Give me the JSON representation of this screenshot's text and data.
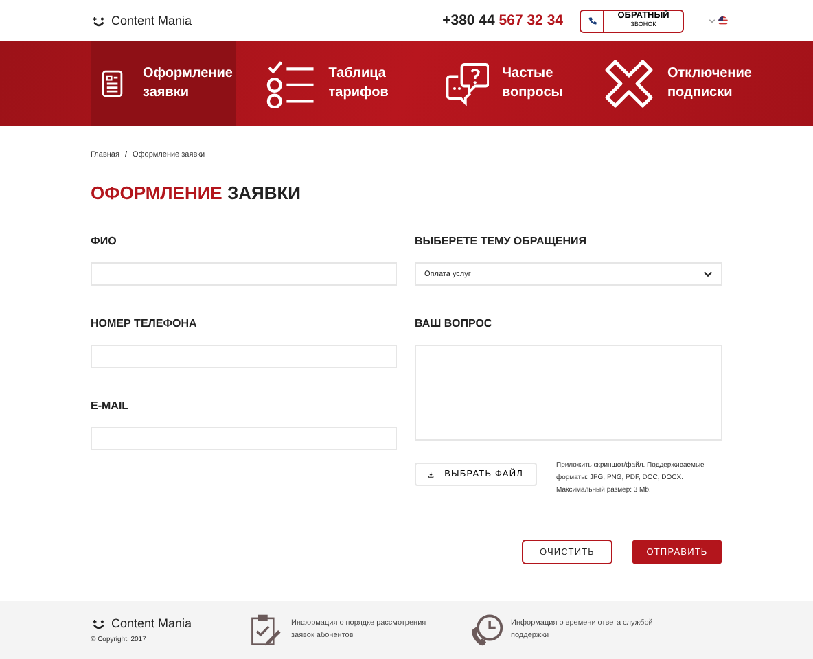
{
  "header": {
    "logo": "Content Mania",
    "phone_prefix": "+380 44",
    "phone_number": "567 32 34",
    "callback_button": [
      "ОБРАТНЫЙ",
      "ЗВОНОК"
    ]
  },
  "nav": [
    {
      "label": "Оформление заявки",
      "kind": "form",
      "selected": true
    },
    {
      "label": "Таблица тарифов",
      "kind": "checklist",
      "selected": false
    },
    {
      "label": "Частые вопросы",
      "kind": "chat",
      "selected": false
    },
    {
      "label": "Отключение подписки",
      "kind": "cross",
      "selected": false
    }
  ],
  "breadcrumbs": {
    "items": [
      "Главная",
      "Оформление заявки"
    ],
    "separator": "/"
  },
  "title": {
    "accent": "ОФОРМЛЕНИЕ",
    "rest": "ЗАЯВКИ"
  },
  "left_fields": [
    {
      "label": "ФИО",
      "kind": "input"
    },
    {
      "label": "НОМЕР ТЕЛЕФОНА",
      "kind": "input"
    },
    {
      "label": "E-MAIL",
      "kind": "input"
    }
  ],
  "right_fields": [
    {
      "label": "ВЫБЕРЕТЕ ТЕМУ ОБРАЩЕНИЯ",
      "kind": "select",
      "value": "Оплата услуг"
    },
    {
      "label": "ВАШ ВОПРОС",
      "kind": "textarea"
    }
  ],
  "file_button": "ВЫБРАТЬ ФАЙЛ",
  "file_hint": "Приложить скриншот/файл. Поддерживаемые форматы: JPG, PNG, PDF, DOC, DOCX. Максимальный размер: 3 Mb.",
  "buttons": {
    "clear": "ОЧИСТИТЬ",
    "submit": "ОТПРАВИТЬ"
  },
  "footer": {
    "logo": "Content Mania",
    "copyright": "© Copyright, 2017",
    "links": [
      {
        "text": "Информация о порядке рассмотрения заявок абонентов",
        "kind": "clipboard"
      },
      {
        "text": "Информация о времени ответа службой поддержки",
        "kind": "clock"
      }
    ]
  }
}
